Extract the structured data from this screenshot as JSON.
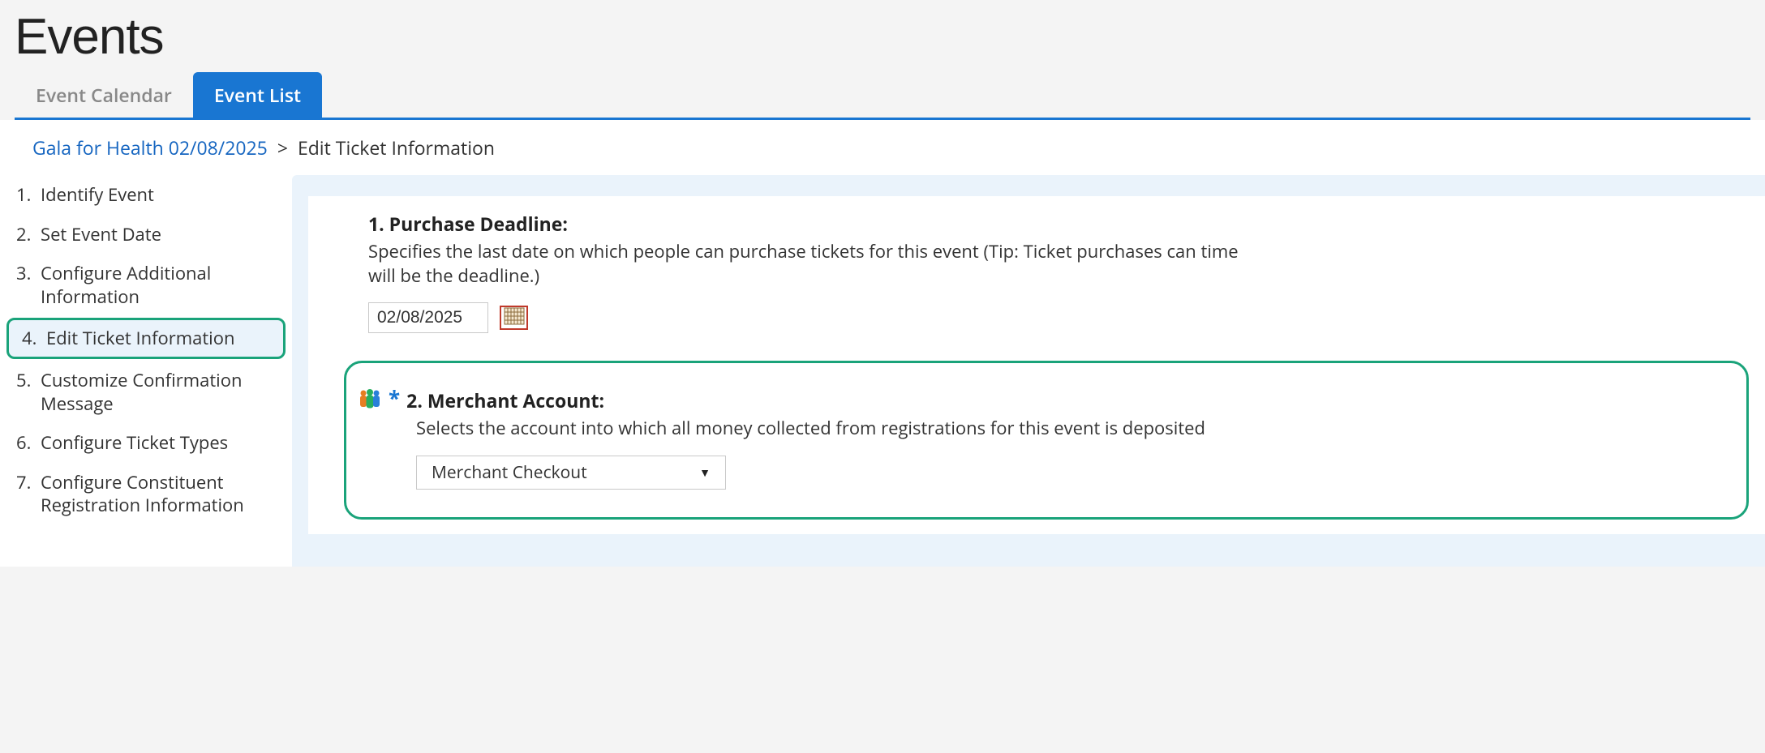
{
  "page": {
    "title": "Events"
  },
  "tabs": {
    "calendar": "Event Calendar",
    "list": "Event List"
  },
  "breadcrumb": {
    "link": "Gala for Health 02/08/2025",
    "sep": ">",
    "current": "Edit Ticket Information"
  },
  "steps": [
    {
      "num": "1.",
      "label": "Identify Event"
    },
    {
      "num": "2.",
      "label": "Set Event Date"
    },
    {
      "num": "3.",
      "label": "Configure Additional Information"
    },
    {
      "num": "4.",
      "label": "Edit Ticket Information"
    },
    {
      "num": "5.",
      "label": "Customize Confirmation Message"
    },
    {
      "num": "6.",
      "label": "Configure Ticket Types"
    },
    {
      "num": "7.",
      "label": "Configure Constituent Registration Information"
    }
  ],
  "section1": {
    "heading": "1. Purchase Deadline:",
    "desc": "Specifies the last date on which people can purchase tickets for this event (Tip: Ticket purchases can time will be the deadline.)",
    "date_value": "02/08/2025"
  },
  "section2": {
    "asterisk": "*",
    "heading": "2. Merchant Account:",
    "desc": "Selects the account into which all money collected from registrations for this event is deposited",
    "select_value": "Merchant Checkout"
  }
}
